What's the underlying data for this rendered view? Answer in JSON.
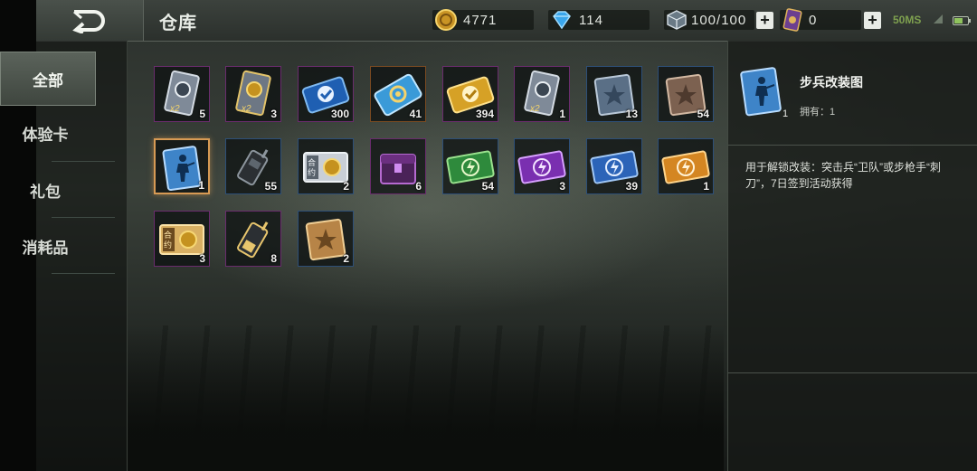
{
  "header": {
    "title": "仓库",
    "gold": "4771",
    "diamond": "114",
    "energy": "100/100",
    "ticket": "0",
    "ping": "50MS"
  },
  "sidebar": {
    "items": [
      {
        "label": "全部",
        "active": true
      },
      {
        "label": "体验卡",
        "active": false
      },
      {
        "label": "礼包",
        "active": false
      },
      {
        "label": "消耗品",
        "active": false
      }
    ]
  },
  "items": [
    {
      "icon": "silver-card-x2-icon",
      "count": "5"
    },
    {
      "icon": "gold-card-x2-icon",
      "count": "3"
    },
    {
      "icon": "blue-medal-ticket-icon",
      "count": "300"
    },
    {
      "icon": "blue-gear-ticket-icon",
      "count": "41"
    },
    {
      "icon": "gold-medal-ticket-icon",
      "count": "394"
    },
    {
      "icon": "silver-card-x2-icon",
      "count": "1"
    },
    {
      "icon": "blue-star-book-icon",
      "count": "13"
    },
    {
      "icon": "brown-star-book-icon",
      "count": "54"
    },
    {
      "icon": "infantry-blueprint-icon",
      "count": "1"
    },
    {
      "icon": "walkie-talkie-icon",
      "count": "55"
    },
    {
      "icon": "contract-card-icon",
      "count": "2"
    },
    {
      "icon": "purple-chest-icon",
      "count": "6"
    },
    {
      "icon": "green-lightning-ticket-icon",
      "count": "54"
    },
    {
      "icon": "purple-lightning-ticket-icon",
      "count": "3"
    },
    {
      "icon": "blue-lightning-ticket-icon",
      "count": "39"
    },
    {
      "icon": "orange-lightning-ticket-icon",
      "count": "1"
    },
    {
      "icon": "gold-contract-card-icon",
      "count": "3"
    },
    {
      "icon": "gold-walkie-talkie-icon",
      "count": "8"
    },
    {
      "icon": "gold-star-book-icon",
      "count": "2"
    }
  ],
  "detail": {
    "name": "步兵改装图",
    "owned": "拥有：1",
    "count": "1",
    "description": "用于解锁改装：突击兵“卫队”或步枪手“刺刀”，7日签到活动获得"
  },
  "colors": {
    "selected_border": "#d79a54",
    "ping_green": "#7ea04f"
  }
}
